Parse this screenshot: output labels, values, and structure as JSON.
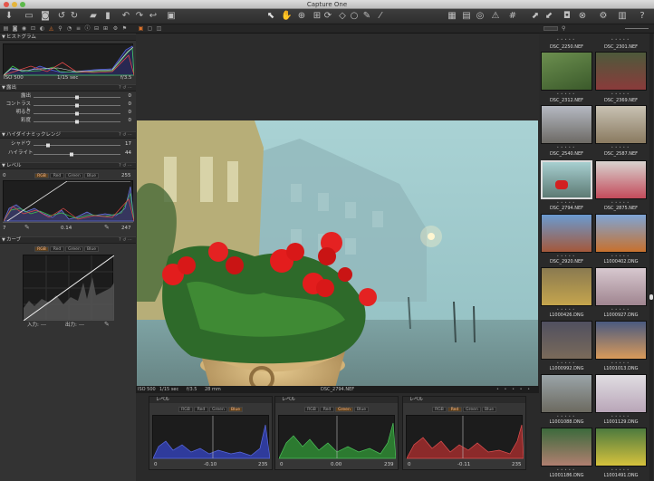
{
  "app": {
    "title": "Capture One"
  },
  "left": {
    "histogram": {
      "title": "ヒストグラム",
      "iso": "ISO 500",
      "shutter": "1/15 sec",
      "aperture": "f/3.5"
    },
    "exposure": {
      "title": "露出",
      "rows": [
        {
          "label": "露出",
          "value": "0"
        },
        {
          "label": "コントラスト",
          "value": "0"
        },
        {
          "label": "明るさ",
          "value": "0"
        },
        {
          "label": "彩度",
          "value": "0"
        }
      ]
    },
    "hdr": {
      "title": "ハイダイナミックレンジ",
      "rows": [
        {
          "label": "シャドウ",
          "value": "17"
        },
        {
          "label": "ハイライト",
          "value": "44"
        }
      ]
    },
    "levels": {
      "title": "レベル",
      "tabs": [
        "RGB",
        "Red",
        "Green",
        "Blue"
      ],
      "top_left": "0",
      "top_right": "255",
      "bottom_left": "7",
      "mid": "0.14",
      "bottom_right": "247"
    },
    "curve": {
      "title": "カーブ",
      "tabs": [
        "RGB",
        "Red",
        "Green",
        "Blue"
      ],
      "input_label": "入力:",
      "input_value": "---",
      "output_label": "出力:",
      "output_value": "---"
    }
  },
  "viewer": {
    "iso": "ISO 500",
    "shutter": "1/15 sec",
    "aperture": "f/3.5",
    "focal": "28 mm",
    "filename": "DSC_2794.NEF"
  },
  "bottom": {
    "panels": [
      {
        "title": "レベル",
        "tabs": [
          "RGB",
          "Red",
          "Green",
          "Blue"
        ],
        "active": 3,
        "left": "0",
        "mid": "-0.10",
        "right": "235"
      },
      {
        "title": "レベル",
        "tabs": [
          "RGB",
          "Red",
          "Green",
          "Blue"
        ],
        "active": 2,
        "left": "0",
        "mid": "0.00",
        "right": "239"
      },
      {
        "title": "レベル",
        "tabs": [
          "RGB",
          "Red",
          "Green",
          "Blue"
        ],
        "active": 1,
        "left": "0",
        "mid": "-0.11",
        "right": "235"
      }
    ]
  },
  "browser": {
    "thumbs": [
      {
        "name": "DSC_2250.NEF"
      },
      {
        "name": "DSC_2301.NEF"
      },
      {
        "name": "DSC_2312.NEF"
      },
      {
        "name": "DSC_2369.NEF"
      },
      {
        "name": "DSC_2540.NEF"
      },
      {
        "name": "DSC_2587.NEF"
      },
      {
        "name": "DSC_2794.NEF"
      },
      {
        "name": "DSC_2875.NEF"
      },
      {
        "name": "DSC_2920.NEF"
      },
      {
        "name": "L1000402.DNG"
      },
      {
        "name": "L1000426.DNG"
      },
      {
        "name": "L1000927.DNG"
      },
      {
        "name": "L1000992.DNG"
      },
      {
        "name": "L1001013.DNG"
      },
      {
        "name": "L1001088.DNG"
      },
      {
        "name": "L1001129.DNG"
      },
      {
        "name": "L1001186.DNG"
      },
      {
        "name": "L1001491.DNG"
      }
    ]
  },
  "colors": {
    "accent": "#e0732a",
    "selected_tab": "#fb8"
  }
}
